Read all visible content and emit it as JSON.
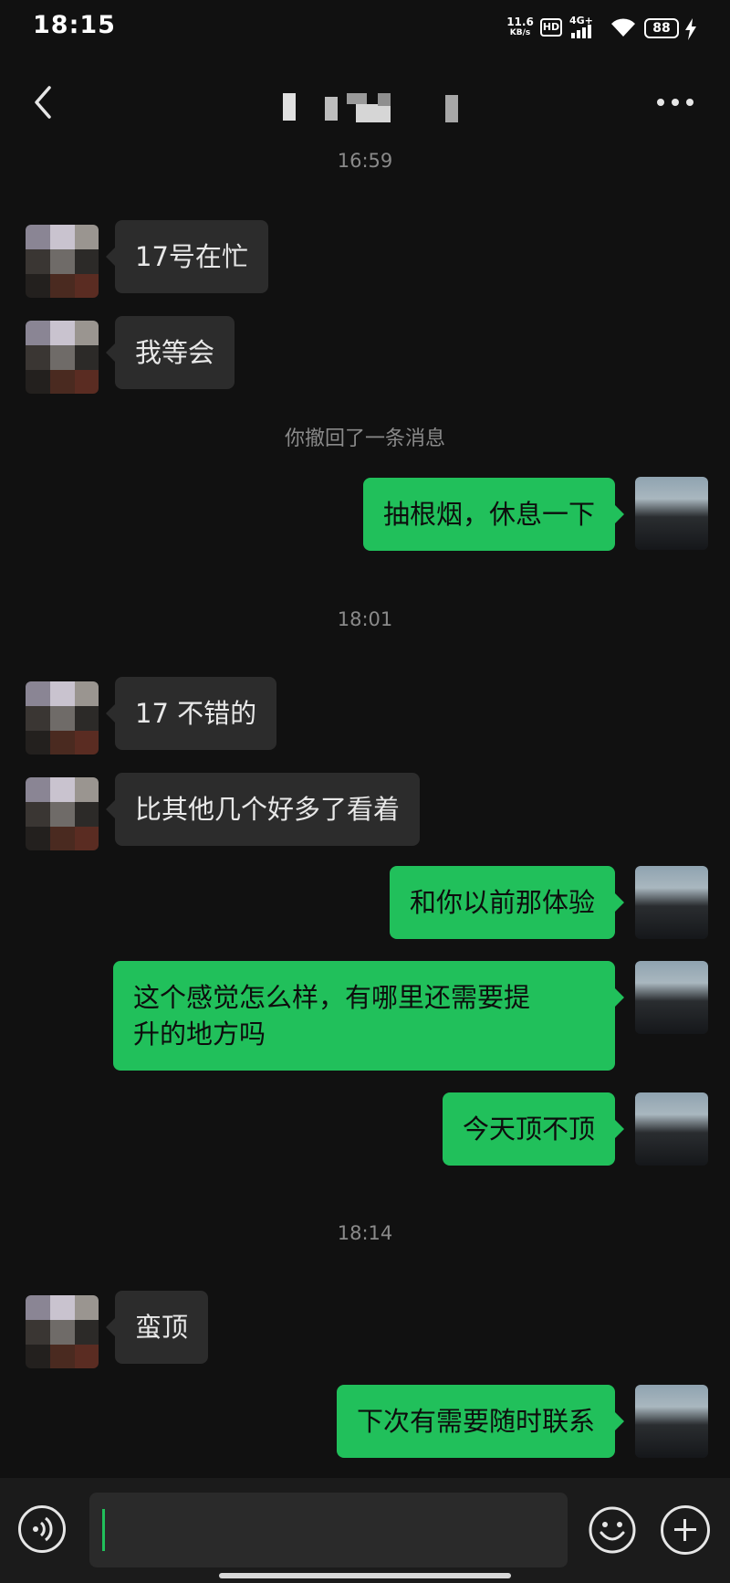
{
  "status_bar": {
    "time": "18:15",
    "net_speed_value": "11.6",
    "net_speed_unit": "KB/s",
    "hd_badge": "HD",
    "network_type": "4G+",
    "battery_level": "88",
    "icons": [
      "hd-icon",
      "signal-4g-icon",
      "wifi-icon",
      "battery-icon",
      "charging-bolt-icon"
    ]
  },
  "header": {
    "icons": [
      "back-icon",
      "more-icon"
    ]
  },
  "messages": [
    {
      "type": "time",
      "text": "16:59"
    },
    {
      "type": "msg",
      "from": "other",
      "text": "17号在忙"
    },
    {
      "type": "msg",
      "from": "other",
      "text": "我等会"
    },
    {
      "type": "system",
      "text": "你撤回了一条消息"
    },
    {
      "type": "msg",
      "from": "me",
      "text": "抽根烟，休息一下"
    },
    {
      "type": "time",
      "text": "18:01"
    },
    {
      "type": "msg",
      "from": "other",
      "text": "17 不错的"
    },
    {
      "type": "msg",
      "from": "other",
      "text": "比其他几个好多了看着"
    },
    {
      "type": "msg",
      "from": "me",
      "text": "和你以前那体验"
    },
    {
      "type": "msg",
      "from": "me",
      "line1": "这个感觉怎么样，有哪里还需要提",
      "line2": "升的地方吗"
    },
    {
      "type": "msg",
      "from": "me",
      "text": "今天顶不顶"
    },
    {
      "type": "time",
      "text": "18:14"
    },
    {
      "type": "msg",
      "from": "other",
      "text": "蛮顶"
    },
    {
      "type": "msg",
      "from": "me",
      "text": "下次有需要随时联系"
    }
  ],
  "input_bar": {
    "value": "",
    "icons": [
      "voice-icon",
      "emoji-icon",
      "plus-icon"
    ]
  },
  "colors": {
    "background": "#111111",
    "incoming_bubble": "#2c2c2c",
    "outgoing_bubble": "#21c05b",
    "timestamp_text": "#8a8a8a"
  }
}
